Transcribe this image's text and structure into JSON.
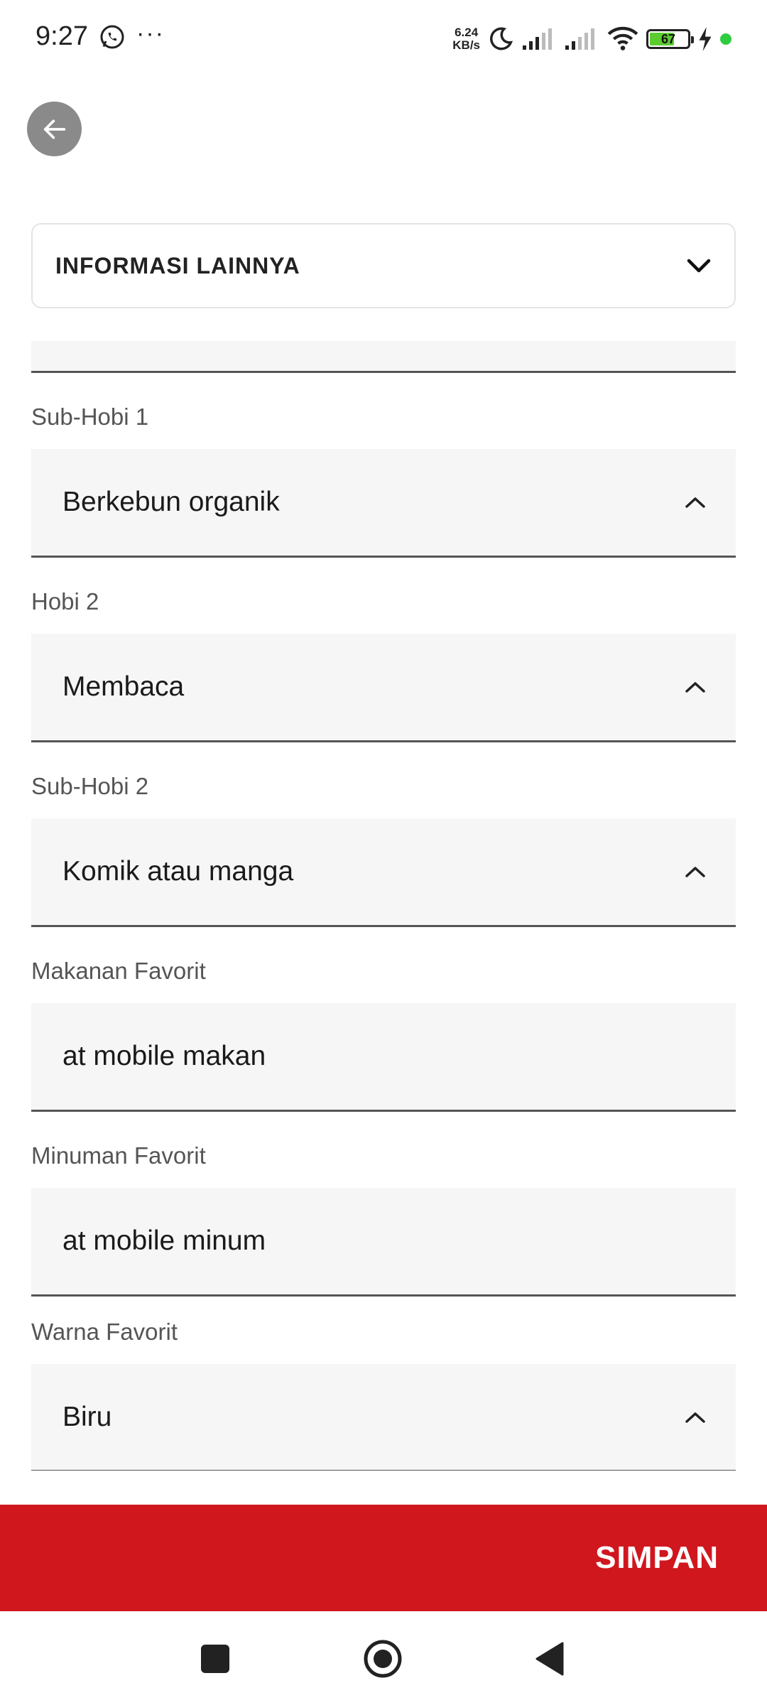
{
  "status_bar": {
    "time": "9:27",
    "more": "···",
    "speed_value": "6.24",
    "speed_unit": "KB/s",
    "battery": "67",
    "battery_level": 0.67,
    "icons": [
      "whatsapp-icon",
      "moon-icon",
      "signal-icon",
      "signal-icon",
      "wifi-icon",
      "battery-icon",
      "charging-icon"
    ]
  },
  "header": {
    "back_icon": "arrow-left-icon"
  },
  "section": {
    "title": "INFORMASI LAINNYA",
    "icon": "chevron-down-icon"
  },
  "form": {
    "fields": [
      {
        "label": "Sub-Hobi 1",
        "value": "Berkebun organik",
        "type": "dropdown"
      },
      {
        "label": "Hobi 2",
        "value": "Membaca",
        "type": "dropdown"
      },
      {
        "label": "Sub-Hobi 2",
        "value": "Komik atau manga",
        "type": "dropdown"
      },
      {
        "label": "Makanan Favorit",
        "value": "at mobile makan",
        "type": "text"
      },
      {
        "label": "Minuman Favorit",
        "value": "at mobile minum",
        "type": "text"
      },
      {
        "label": "Warna Favorit",
        "value": "Biru",
        "type": "dropdown"
      }
    ]
  },
  "actions": {
    "save_label": "SIMPAN"
  },
  "colors": {
    "accent": "#d0171e",
    "field_bg": "#f6f6f6",
    "back_button": "#8a8a8a"
  }
}
